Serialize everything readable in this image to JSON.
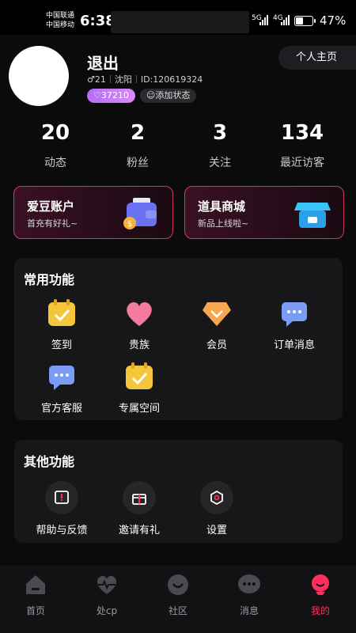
{
  "status_bar": {
    "carrier1": "中国联通",
    "carrier2": "中国移动",
    "time": "6:38",
    "net1": "5G",
    "net2": "4G",
    "battery": "47%"
  },
  "profile": {
    "name": "退出",
    "gender_age": "♂21",
    "city": "沈阳",
    "id": "ID:120619324",
    "coins": "♡37210",
    "add_status": "添加状态",
    "homepage_label": "个人主页"
  },
  "stats": [
    {
      "value": "20",
      "label": "动态"
    },
    {
      "value": "2",
      "label": "粉丝"
    },
    {
      "value": "3",
      "label": "关注"
    },
    {
      "value": "134",
      "label": "最近访客"
    }
  ],
  "promos": [
    {
      "title": "爱豆账户",
      "subtitle": "首充有好礼~"
    },
    {
      "title": "道具商城",
      "subtitle": "新品上线啦~"
    }
  ],
  "common": {
    "title": "常用功能",
    "items": [
      {
        "label": "签到",
        "icon": "calendar-check-icon"
      },
      {
        "label": "贵族",
        "icon": "heart-icon"
      },
      {
        "label": "会员",
        "icon": "diamond-icon"
      },
      {
        "label": "订单消息",
        "icon": "chat-bubble-icon"
      },
      {
        "label": "官方客服",
        "icon": "chat-bubble-icon"
      },
      {
        "label": "专属空间",
        "icon": "calendar-check-icon"
      }
    ]
  },
  "other": {
    "title": "其他功能",
    "items": [
      {
        "label": "帮助与反馈",
        "icon": "help-book-icon"
      },
      {
        "label": "邀请有礼",
        "icon": "gift-icon"
      },
      {
        "label": "设置",
        "icon": "settings-icon"
      }
    ]
  },
  "nav": [
    {
      "label": "首页",
      "icon": "home-icon"
    },
    {
      "label": "处cp",
      "icon": "heartbeat-icon"
    },
    {
      "label": "社区",
      "icon": "community-icon"
    },
    {
      "label": "消息",
      "icon": "message-icon"
    },
    {
      "label": "我的",
      "icon": "profile-icon"
    }
  ],
  "colors": {
    "accent": "#ff2e5d",
    "badge_purple": "#c77df6",
    "card_border": "#d3356f"
  }
}
